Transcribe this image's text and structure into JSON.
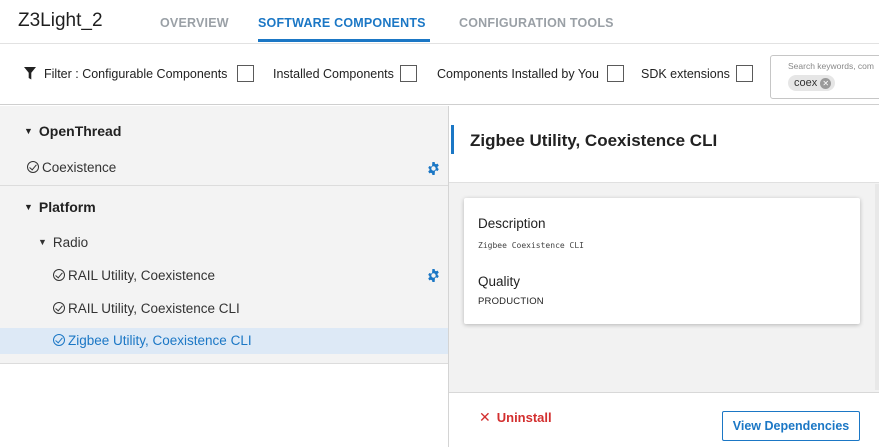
{
  "header": {
    "project_title": "Z3Light_2",
    "tabs": [
      {
        "label": "OVERVIEW"
      },
      {
        "label": "SOFTWARE COMPONENTS"
      },
      {
        "label": "CONFIGURATION TOOLS"
      }
    ],
    "active_tab": "SOFTWARE COMPONENTS"
  },
  "filter": {
    "label": "Filter : Configurable Components",
    "options": [
      {
        "label": "Installed Components",
        "checked": false
      },
      {
        "label": "Components Installed by You",
        "checked": false
      },
      {
        "label": "SDK extensions",
        "checked": false
      }
    ],
    "configurable_checked": false,
    "search": {
      "placeholder": "Search keywords, com",
      "chip": "coex"
    }
  },
  "tree": {
    "groups": [
      {
        "label": "OpenThread",
        "items": [
          {
            "label": "Coexistence",
            "configurable": true
          }
        ]
      },
      {
        "label": "Platform",
        "subgroup": "Radio",
        "items": [
          {
            "label": "RAIL Utility, Coexistence",
            "configurable": true
          },
          {
            "label": "RAIL Utility, Coexistence CLI",
            "configurable": false
          },
          {
            "label": "Zigbee Utility, Coexistence CLI",
            "configurable": false,
            "selected": true
          }
        ]
      }
    ]
  },
  "detail": {
    "title": "Zigbee Utility, Coexistence CLI",
    "description_label": "Description",
    "description": "Zigbee Coexistence CLI",
    "quality_label": "Quality",
    "quality": "PRODUCTION",
    "uninstall_label": "Uninstall",
    "view_dependencies_label": "View Dependencies"
  },
  "colors": {
    "accent": "#1b77c5",
    "selected_bg": "#dde9f6",
    "danger": "#d32f2f"
  }
}
